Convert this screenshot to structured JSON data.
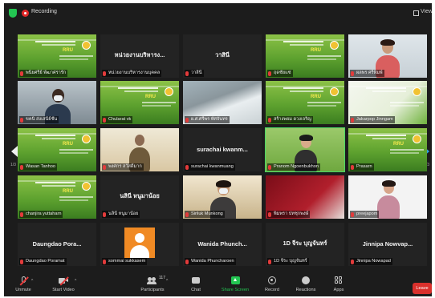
{
  "top_bar": {
    "recording_label": "Recording",
    "view_label": "View"
  },
  "pagination": {
    "left": "1/3",
    "right": "1/3"
  },
  "tiles": [
    {
      "row": 0,
      "col": 0,
      "kind": "slide",
      "label": "พนิยศรีย์ พัฒาศรารัก",
      "muted": true
    },
    {
      "row": 0,
      "col": 1,
      "kind": "name",
      "display": "หน่วยงานบริหารง...",
      "label": "หน่วยงานบริหารงานบุคคล",
      "muted": true
    },
    {
      "row": 0,
      "col": 2,
      "kind": "name",
      "display": "วาสินี",
      "label": "วาสินี",
      "muted": true
    },
    {
      "row": 0,
      "col": 3,
      "kind": "slide",
      "label": "ฤดชัยแซ่",
      "muted": true
    },
    {
      "row": 0,
      "col": 4,
      "kind": "video-woman-glasses",
      "label": "ผลพร ศรีพิมพ์",
      "muted": true
    },
    {
      "row": 1,
      "col": 0,
      "kind": "video-man-mask",
      "label": "ขคนิ ส่งเสนีย์ชั้น",
      "muted": true
    },
    {
      "row": 1,
      "col": 1,
      "kind": "slide",
      "label": "Chularat vk",
      "muted": true
    },
    {
      "row": 1,
      "col": 2,
      "kind": "video-room",
      "label": "ผ.ศ.ศรีพร ทัศจันทร",
      "muted": true
    },
    {
      "row": 1,
      "col": 3,
      "kind": "slide",
      "label": "สร้างพยม ดวงเจริญ",
      "muted": true
    },
    {
      "row": 1,
      "col": 4,
      "kind": "slide-light",
      "label": "Jakarpop Jinngam",
      "muted": true
    },
    {
      "row": 2,
      "col": 0,
      "kind": "slide",
      "label": "Wasan Tanhoo",
      "muted": true
    },
    {
      "row": 2,
      "col": 1,
      "kind": "video-man-uniform",
      "label": "พงศกร สวัสดิ์มาก",
      "muted": true
    },
    {
      "row": 2,
      "col": 2,
      "kind": "name",
      "display": "surachai kwanm...",
      "label": "surachai kwanmuang",
      "muted": true
    },
    {
      "row": 2,
      "col": 3,
      "kind": "video-woman-green",
      "label": "Pranom Ngoenbukhon",
      "muted": true,
      "active": true
    },
    {
      "row": 2,
      "col": 4,
      "kind": "slide",
      "label": "Prasarn",
      "muted": true
    },
    {
      "row": 3,
      "col": 0,
      "kind": "slide",
      "label": "chanjira yuttaharn",
      "muted": true
    },
    {
      "row": 3,
      "col": 1,
      "kind": "name",
      "display": "นลินี หนูมาน้อย",
      "label": "นลินี หนูมาน้อย",
      "muted": true
    },
    {
      "row": 3,
      "col": 2,
      "kind": "video-woman-mask",
      "label": "Siriluk Munkong",
      "muted": true
    },
    {
      "row": 3,
      "col": 3,
      "kind": "video-red-slide",
      "label": "พิมพรา ปทชุกพงษ์",
      "muted": true
    },
    {
      "row": 3,
      "col": 4,
      "kind": "video-woman-light",
      "label": "preejapom",
      "muted": true
    },
    {
      "row": 4,
      "col": 0,
      "kind": "name",
      "display": "Daungdao Pora...",
      "label": "Daungdao Poramat",
      "muted": true
    },
    {
      "row": 4,
      "col": 1,
      "kind": "avatar",
      "label": "sommai sukkasem",
      "muted": true
    },
    {
      "row": 4,
      "col": 2,
      "kind": "name",
      "display": "Wanida Phunch...",
      "label": "Wanida Phuncharoen",
      "muted": true
    },
    {
      "row": 4,
      "col": 3,
      "kind": "name",
      "display": "1D จีระ บุญจันทร์",
      "label": "1D จีระ บุญจันทร์",
      "muted": true
    },
    {
      "row": 4,
      "col": 4,
      "kind": "name",
      "display": "Jinnipa Nowvap...",
      "label": "Jinnipa Nowapad",
      "muted": true
    }
  ],
  "toolbar": {
    "unmute": "Unmute",
    "start_video": "Start Video",
    "participants": "Participants",
    "participants_count": "117",
    "chat": "Chat",
    "share_screen": "Share Screen",
    "record": "Record",
    "reactions": "Reactions",
    "apps": "Apps",
    "leave": "Leave"
  },
  "colors": {
    "background": "#1c1c1c",
    "tile": "#232323",
    "active_speaker": "#4cd964",
    "share_green": "#23c552",
    "leave_red": "#d9302c",
    "nav_arrow_blue": "#2aa3e8"
  }
}
